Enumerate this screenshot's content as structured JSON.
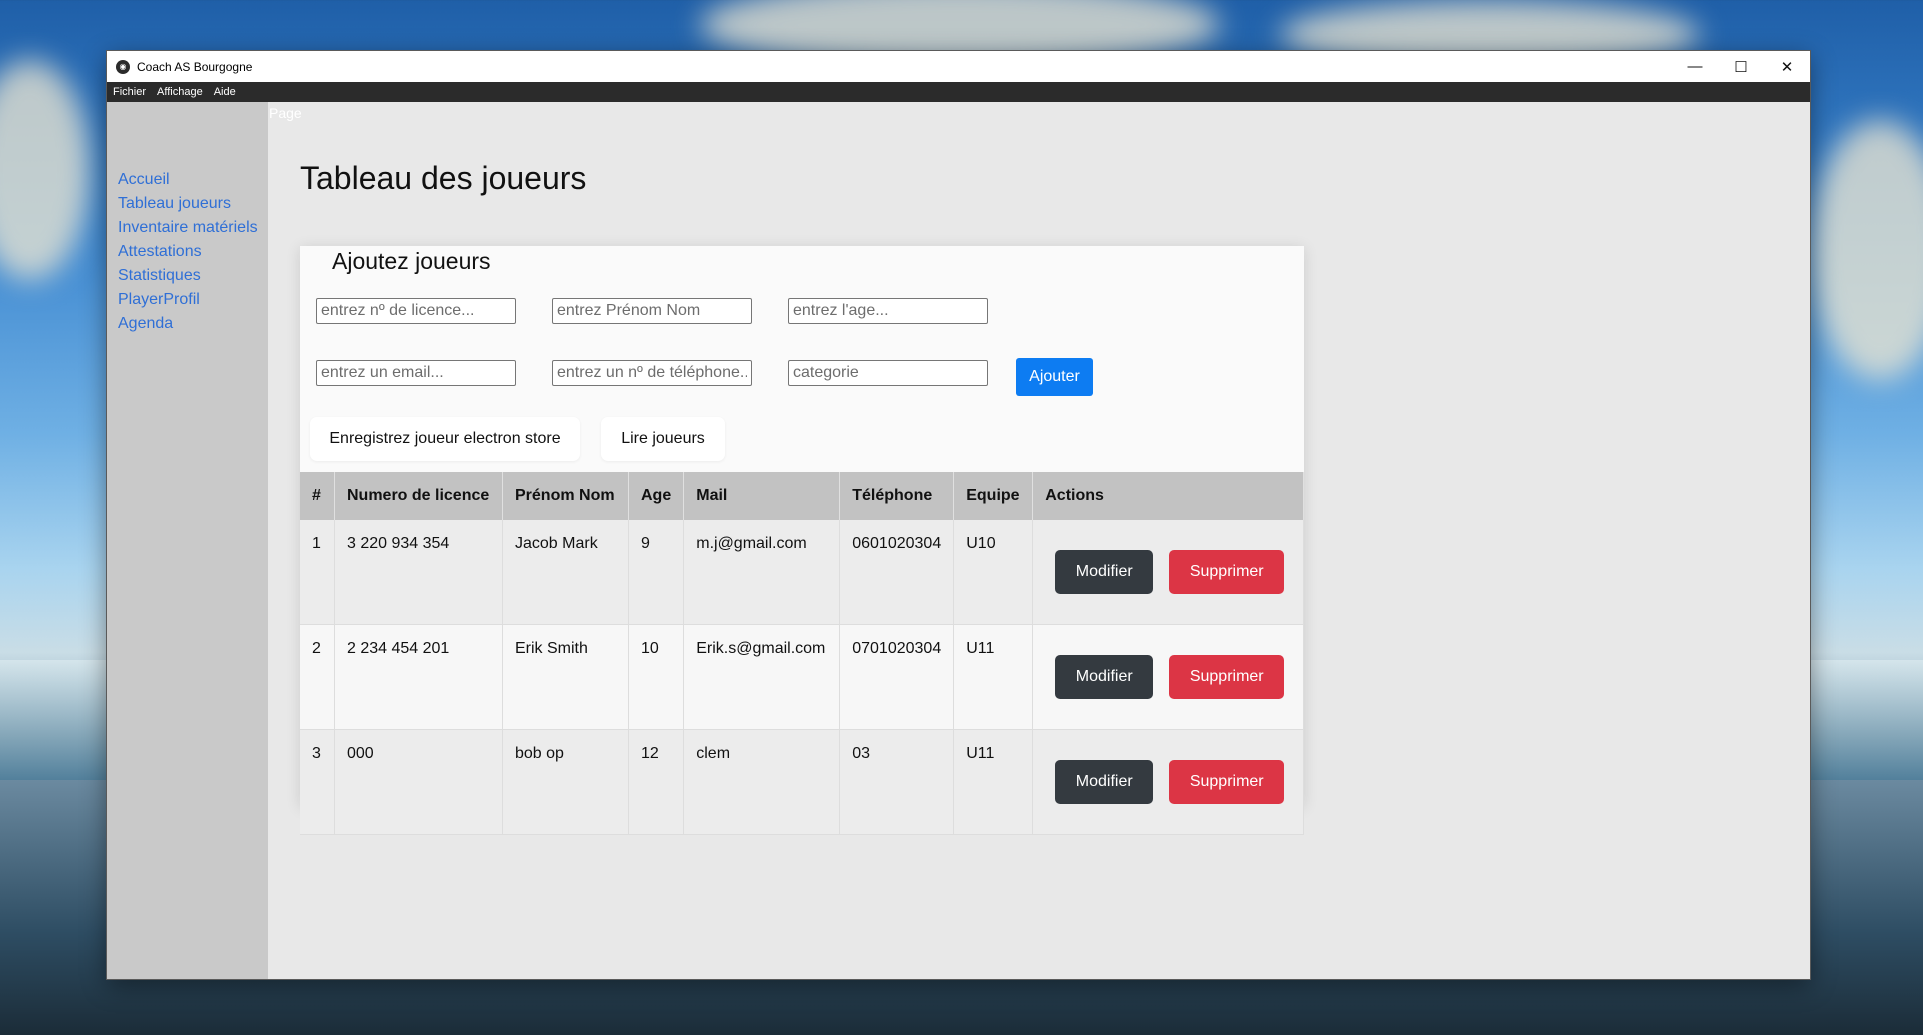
{
  "window": {
    "title": "Coach AS Bourgogne",
    "controls": [
      "—",
      "☐",
      "✕"
    ]
  },
  "menubar": {
    "items": [
      "Fichier",
      "Affichage",
      "Aide"
    ]
  },
  "sidebar": {
    "items": [
      {
        "label": "Accueil"
      },
      {
        "label": "Tableau joueurs"
      },
      {
        "label": "Inventaire matériels"
      },
      {
        "label": "Attestations"
      },
      {
        "label": "Statistiques"
      },
      {
        "label": "PlayerProfil"
      },
      {
        "label": "Agenda"
      }
    ],
    "link_color": "#2f6fd6"
  },
  "main": {
    "page_label": "Page",
    "title": "Tableau des joueurs"
  },
  "form": {
    "title": "Ajoutez joueurs",
    "placeholders": {
      "licence": "entrez nº de licence...",
      "name": "entrez Prénom Nom",
      "age": "entrez l'age...",
      "email": "entrez un email...",
      "phone": "entrez un nº de téléphone...",
      "category": "categorie"
    },
    "add_button": "Ajouter",
    "save_button": "Enregistrez joueur electron store",
    "read_button": "Lire joueurs"
  },
  "table": {
    "headers": [
      "#",
      "Numero de licence",
      "Prénom Nom",
      "Age",
      "Mail",
      "Téléphone",
      "Equipe",
      "Actions"
    ],
    "rows": [
      {
        "num": "1",
        "licence": "3 220 934 354",
        "name": "Jacob Mark",
        "age": "9",
        "mail": "m.j@gmail.com",
        "phone": "0601020304",
        "team": "U10"
      },
      {
        "num": "2",
        "licence": "2 234 454 201",
        "name": "Erik Smith",
        "age": "10",
        "mail": "Erik.s@gmail.com",
        "phone": "0701020304",
        "team": "U11"
      },
      {
        "num": "3",
        "licence": "000",
        "name": "bob op",
        "age": "12",
        "mail": "clem",
        "phone": "03",
        "team": "U11"
      }
    ],
    "edit_label": "Modifier",
    "delete_label": "Supprimer"
  },
  "colors": {
    "primary": "#0d7cf2",
    "danger": "#dc3545",
    "dark": "#343a40",
    "sidebar_bg": "#c9c9c9",
    "menubar_bg": "#2b2b2b"
  }
}
